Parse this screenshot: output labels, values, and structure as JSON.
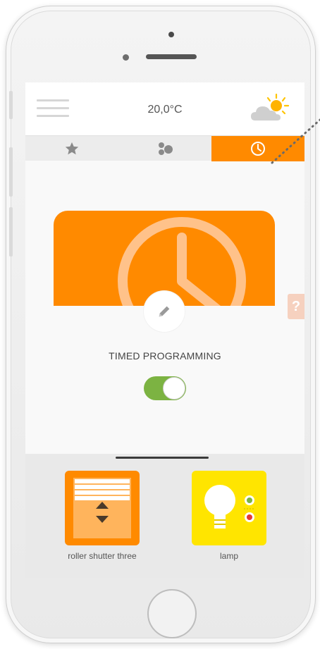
{
  "header": {
    "temperature": "20,0°C",
    "weather_icon": "partly-sunny-icon"
  },
  "tabs": [
    {
      "icon": "star-icon",
      "active": false
    },
    {
      "icon": "scenes-icon",
      "active": false
    },
    {
      "icon": "clock-icon",
      "active": true
    }
  ],
  "program": {
    "label": "TIMED PROGRAMMING",
    "enabled": true,
    "edit_icon": "pencil-icon",
    "help_label": "?"
  },
  "devices": [
    {
      "name": "roller shutter three",
      "icon": "roller-shutter-icon",
      "color": "#ff8a00"
    },
    {
      "name": "lamp",
      "icon": "lamp-icon",
      "color": "#ffe500"
    }
  ],
  "colors": {
    "accent": "#ff8a00",
    "toggle_on": "#7cb342"
  }
}
